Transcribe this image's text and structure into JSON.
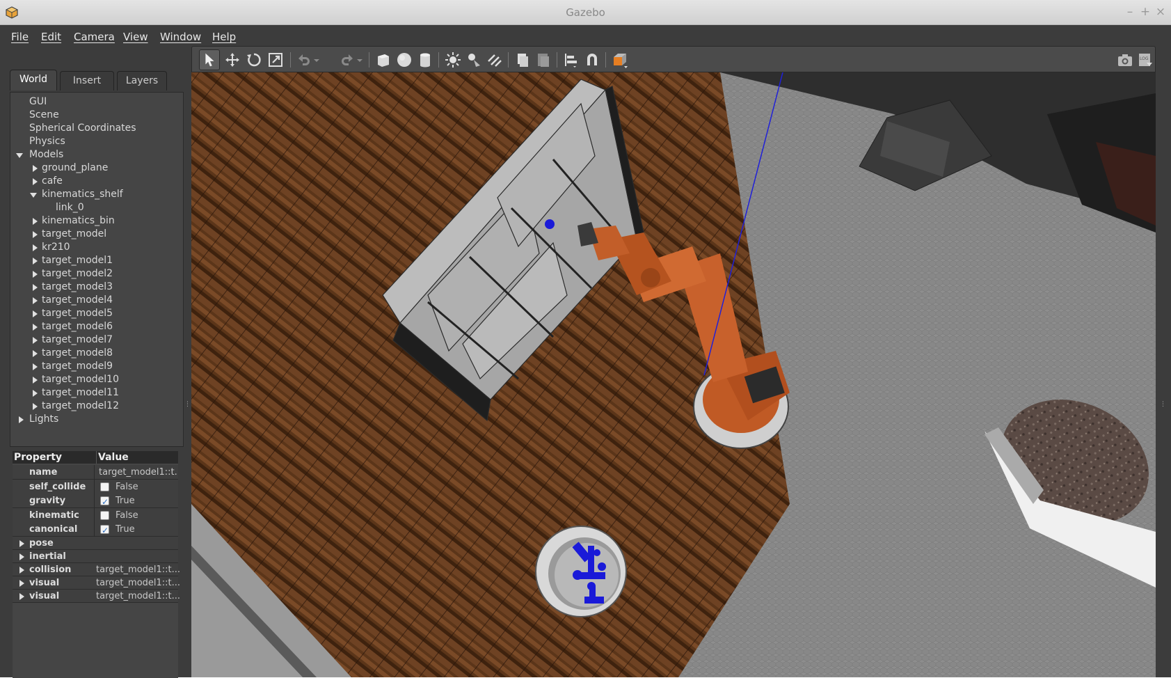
{
  "window": {
    "title": "Gazebo"
  },
  "menu": [
    "File",
    "Edit",
    "Camera",
    "View",
    "Window",
    "Help"
  ],
  "tabs": [
    "World",
    "Insert",
    "Layers"
  ],
  "tree": {
    "gui": "GUI",
    "scene": "Scene",
    "spherical": "Spherical Coordinates",
    "physics": "Physics",
    "models": "Models",
    "model_items": [
      "ground_plane",
      "cafe",
      "kinematics_shelf",
      "link_0",
      "kinematics_bin",
      "target_model",
      "kr210",
      "target_model1",
      "target_model2",
      "target_model3",
      "target_model4",
      "target_model5",
      "target_model6",
      "target_model7",
      "target_model8",
      "target_model9",
      "target_model10",
      "target_model11",
      "target_model12"
    ],
    "lights": "Lights"
  },
  "props": {
    "header_property": "Property",
    "header_value": "Value",
    "rows": [
      {
        "key": "name",
        "value": "target_model1::t..."
      },
      {
        "key": "self_collide",
        "value": "False",
        "checked": false
      },
      {
        "key": "gravity",
        "value": "True",
        "checked": true
      },
      {
        "key": "kinematic",
        "value": "False",
        "checked": false
      },
      {
        "key": "canonical",
        "value": "True",
        "checked": true
      }
    ],
    "expanders": [
      {
        "key": "pose",
        "value": ""
      },
      {
        "key": "inertial",
        "value": ""
      },
      {
        "key": "collision",
        "value": "target_model1::t..."
      },
      {
        "key": "visual",
        "value": "target_model1::t..."
      },
      {
        "key": "visual",
        "value": "target_model1::t..."
      }
    ]
  },
  "toolbar": {
    "tools": [
      "select-arrow-icon",
      "translate-icon",
      "rotate-icon",
      "scale-icon",
      "undo-icon",
      "redo-icon",
      "box-icon",
      "sphere-icon",
      "cylinder-icon",
      "point-light-icon",
      "spot-light-icon",
      "directional-light-icon",
      "copy-icon",
      "paste-icon",
      "align-icon",
      "snap-icon",
      "view-angle-icon",
      "screenshot-icon",
      "log-icon"
    ]
  },
  "colors": {
    "accent": "#e67e22",
    "floor_wood": "#5a3418",
    "floor_tile": "#8a8a8a",
    "robot": "#c8612c",
    "objects": "#1a1ad8"
  }
}
